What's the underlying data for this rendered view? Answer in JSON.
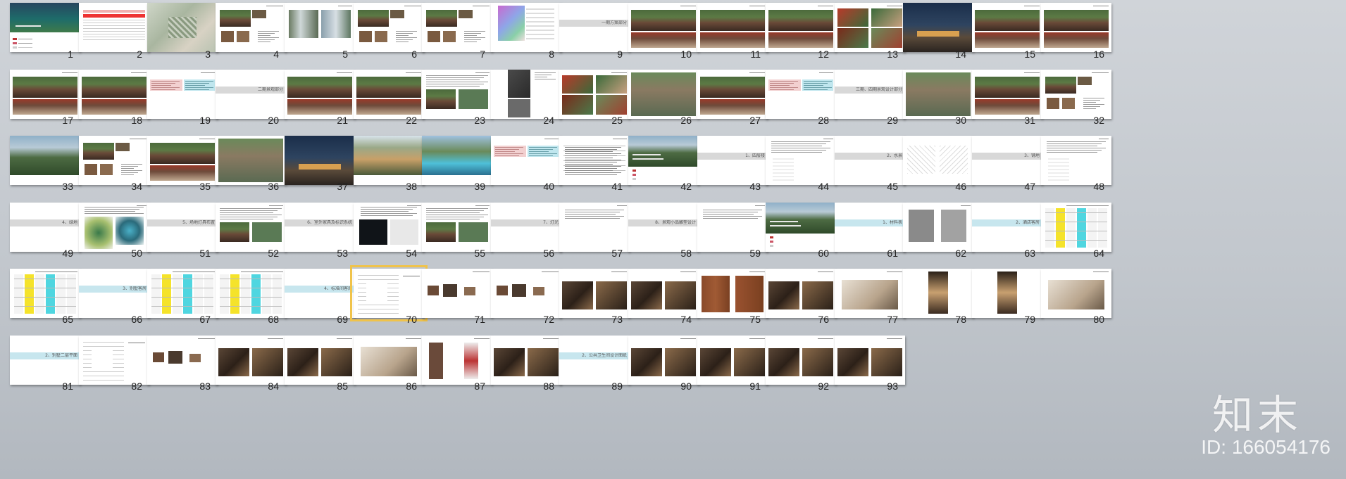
{
  "watermark": {
    "logo": "知末",
    "id_text": "ID: 166054176"
  },
  "selected_slide": 70,
  "section_titles": {
    "9": "一期方案部分",
    "20": "二期景观部分",
    "29": "三期、四期景观设计部分",
    "43": "1、四层楼",
    "45": "2、水景",
    "47": "3、铺地",
    "49": "4、绿地",
    "51": "5、场地灯具布置",
    "53": "6、室外家具及标识系统",
    "56": "7、灯光",
    "58": "8、景观小品雕塑设计",
    "61": "1、材料表",
    "63": "2、酒店客房",
    "66": "3、别墅客房",
    "69": "4、标准间客房",
    "81": "2、别墅二层平面",
    "89": "2、公共卫生间设计图纸"
  },
  "colors": {
    "selection": "#f0c34a",
    "section_band": "#d8d8d8",
    "cyan_band": "#c7e6ee",
    "accent_cyan": "#4fd6e0",
    "accent_yellow": "#f5e32a"
  }
}
